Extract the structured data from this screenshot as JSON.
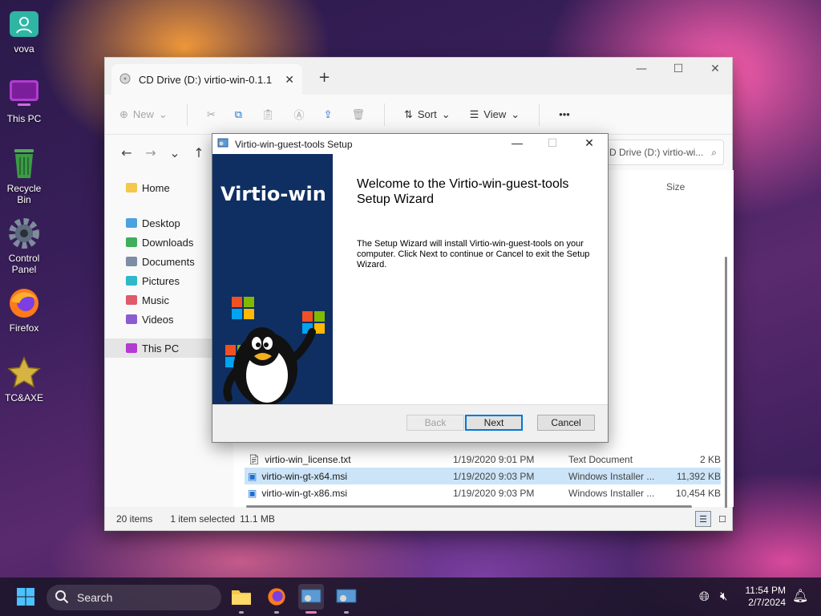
{
  "desktop": {
    "icons": [
      {
        "label": "vova"
      },
      {
        "label": "This PC"
      },
      {
        "label": "Recycle Bin"
      },
      {
        "label": "Control Panel"
      },
      {
        "label": "Firefox"
      },
      {
        "label": "TC&AXE"
      }
    ]
  },
  "explorer": {
    "tab_title": "CD Drive (D:) virtio-win-0.1.1",
    "tab_close": "✕",
    "new_tab": "+",
    "window_controls": {
      "minimize": "—",
      "maximize": "☐",
      "close": "✕"
    },
    "toolbar": {
      "new_label": "New",
      "sort_label": "Sort",
      "view_label": "View",
      "more_label": "•••"
    },
    "address": "D Drive (D:) virtio-wi...",
    "sidebar": {
      "home": "Home",
      "items": [
        {
          "label": "Desktop",
          "color": "#4aa3df"
        },
        {
          "label": "Downloads",
          "color": "#3fae5a"
        },
        {
          "label": "Documents",
          "color": "#7d8ea6"
        },
        {
          "label": "Pictures",
          "color": "#2eb8c9"
        },
        {
          "label": "Music",
          "color": "#e05a6a"
        },
        {
          "label": "Videos",
          "color": "#8a5cd1"
        }
      ],
      "this_pc": "This PC"
    },
    "columns": {
      "size": "Size"
    },
    "files": [
      {
        "name": "virtio-win_license.txt",
        "date": "1/19/2020 9:01 PM",
        "type": "Text Document",
        "size": "2 KB"
      },
      {
        "name": "virtio-win-gt-x64.msi",
        "date": "1/19/2020 9:03 PM",
        "type": "Windows Installer ...",
        "size": "11,392 KB"
      },
      {
        "name": "virtio-win-gt-x86.msi",
        "date": "1/19/2020 9:03 PM",
        "type": "Windows Installer ...",
        "size": "10,454 KB"
      }
    ],
    "status": {
      "items": "20 items",
      "selected": "1 item selected",
      "size": "11.1 MB"
    }
  },
  "dialog": {
    "title": "Virtio-win-guest-tools Setup",
    "brand": "Virtio-win",
    "heading": "Welcome to the Virtio-win-guest-tools Setup Wizard",
    "body": "The Setup Wizard will install Virtio-win-guest-tools on your computer. Click Next to continue or Cancel to exit the Setup Wizard.",
    "buttons": {
      "back": "Back",
      "next": "Next",
      "cancel": "Cancel"
    }
  },
  "taskbar": {
    "search_placeholder": "Search",
    "time": "11:54 PM",
    "date": "2/7/2024"
  }
}
